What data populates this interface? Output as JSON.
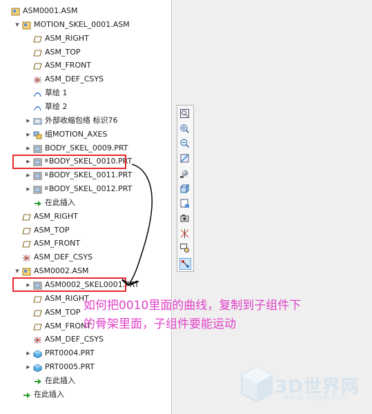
{
  "model_tree": {
    "rows": [
      {
        "label": "ASM0001.ASM",
        "icon": "assembly-icon",
        "indent": 0,
        "expander": ""
      },
      {
        "label": "MOTION_SKEL_0001.ASM",
        "icon": "assembly-icon",
        "indent": 1,
        "expander": "▼"
      },
      {
        "label": "ASM_RIGHT",
        "icon": "datum-plane-icon",
        "indent": 2,
        "expander": ""
      },
      {
        "label": "ASM_TOP",
        "icon": "datum-plane-icon",
        "indent": 2,
        "expander": ""
      },
      {
        "label": "ASM_FRONT",
        "icon": "datum-plane-icon",
        "indent": 2,
        "expander": ""
      },
      {
        "label": "ASM_DEF_CSYS",
        "icon": "csys-icon",
        "indent": 2,
        "expander": ""
      },
      {
        "label": "草绘 1",
        "icon": "sketch-icon",
        "indent": 2,
        "expander": ""
      },
      {
        "label": "草绘 2",
        "icon": "sketch-icon",
        "indent": 2,
        "expander": ""
      },
      {
        "label": "外部收缩包络 标识76",
        "icon": "shrinkwrap-icon",
        "indent": 2,
        "expander": "▶"
      },
      {
        "label": "组MOTION_AXES",
        "icon": "group-icon",
        "indent": 2,
        "expander": "▶"
      },
      {
        "label": "BODY_SKEL_0009.PRT",
        "icon": "part-icon",
        "indent": 2,
        "expander": "▶",
        "sup": ""
      },
      {
        "label": "BODY_SKEL_0010.PRT",
        "icon": "part-icon",
        "indent": 2,
        "expander": "▶",
        "sup": "B"
      },
      {
        "label": "BODY_SKEL_0011.PRT",
        "icon": "part-icon",
        "indent": 2,
        "expander": "▶",
        "sup": "B"
      },
      {
        "label": "BODY_SKEL_0012.PRT",
        "icon": "part-icon",
        "indent": 2,
        "expander": "▶",
        "sup": "B"
      },
      {
        "label": "在此插入",
        "icon": "insert-here-icon",
        "indent": 2,
        "expander": ""
      },
      {
        "label": "ASM_RIGHT",
        "icon": "datum-plane-icon",
        "indent": 1,
        "expander": ""
      },
      {
        "label": "ASM_TOP",
        "icon": "datum-plane-icon",
        "indent": 1,
        "expander": ""
      },
      {
        "label": "ASM_FRONT",
        "icon": "datum-plane-icon",
        "indent": 1,
        "expander": ""
      },
      {
        "label": "ASM_DEF_CSYS",
        "icon": "csys-icon",
        "indent": 1,
        "expander": ""
      },
      {
        "label": "ASM0002.ASM",
        "icon": "assembly-icon",
        "indent": 1,
        "expander": "▼"
      },
      {
        "label": "ASM0002_SKEL0001.PRT",
        "icon": "part-icon",
        "indent": 2,
        "expander": "▶"
      },
      {
        "label": "ASM_RIGHT",
        "icon": "datum-plane-icon",
        "indent": 2,
        "expander": ""
      },
      {
        "label": "ASM_TOP",
        "icon": "datum-plane-icon",
        "indent": 2,
        "expander": ""
      },
      {
        "label": "ASM_FRONT",
        "icon": "datum-plane-icon",
        "indent": 2,
        "expander": ""
      },
      {
        "label": "ASM_DEF_CSYS",
        "icon": "csys-icon",
        "indent": 2,
        "expander": ""
      },
      {
        "label": "PRT0004.PRT",
        "icon": "solid-part-icon",
        "indent": 2,
        "expander": "▶"
      },
      {
        "label": "PRT0005.PRT",
        "icon": "solid-part-icon",
        "indent": 2,
        "expander": "▶"
      },
      {
        "label": "在此插入",
        "icon": "insert-here-icon",
        "indent": 2,
        "expander": ""
      },
      {
        "label": "在此插入",
        "icon": "insert-here-icon",
        "indent": 1,
        "expander": ""
      }
    ]
  },
  "view_toolbar": {
    "buttons": [
      {
        "name": "refit-icon"
      },
      {
        "name": "zoom-in-icon"
      },
      {
        "name": "zoom-out-icon"
      },
      {
        "name": "repaint-icon"
      },
      {
        "name": "display-style-icon"
      },
      {
        "name": "saved-orientations-icon"
      },
      {
        "name": "view-manager-icon"
      },
      {
        "name": "perspective-icon"
      },
      {
        "name": "datum-display-icon"
      },
      {
        "name": "spin-center-icon"
      },
      {
        "name": "annotation-display-icon",
        "active": true
      }
    ]
  },
  "annotation": {
    "line1": "如何把0010里面的曲线，复制到子组件下",
    "line2": "的骨架里面，子组件要能运动",
    "color": "#e040c8"
  },
  "colors": {
    "highlight_box": "#e8262a"
  },
  "watermark": {
    "brand": "3D世界网",
    "url": "WWW.3DSJW.COM"
  }
}
